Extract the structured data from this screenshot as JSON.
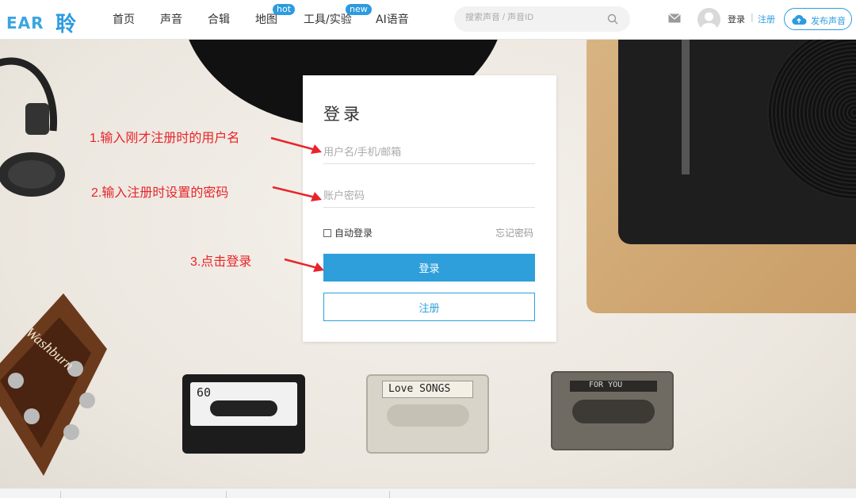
{
  "header": {
    "logo_text": "EAR",
    "logo_char": "聆",
    "nav": [
      {
        "label": "首页"
      },
      {
        "label": "声音"
      },
      {
        "label": "合辑"
      },
      {
        "label": "地图",
        "badge": "hot"
      },
      {
        "label": "工具/实验",
        "badge": "new"
      },
      {
        "label": "AI语音"
      }
    ],
    "search_placeholder": "搜索声音 / 声音ID",
    "login_label": "登录",
    "separator": "|",
    "register_label": "注册",
    "publish_label": "发布声音"
  },
  "login": {
    "title": "登录",
    "username_placeholder": "用户名/手机/邮箱",
    "password_placeholder": "账户密码",
    "remember_label": "自动登录",
    "forgot_label": "忘记密码",
    "login_button": "登录",
    "register_button": "注册"
  },
  "annotations": {
    "step1": "1.输入刚才注册时的用户名",
    "step2": "2.输入注册时设置的密码",
    "step3": "3.点击登录"
  },
  "scene": {
    "cassettes": [
      {
        "label": "60"
      },
      {
        "label": "Love SONGS"
      },
      {
        "label": "FOR YOU"
      }
    ],
    "guitar_brand": "Washburn"
  },
  "colors": {
    "accent": "#2e9fdb",
    "annotation": "#e8242a"
  }
}
